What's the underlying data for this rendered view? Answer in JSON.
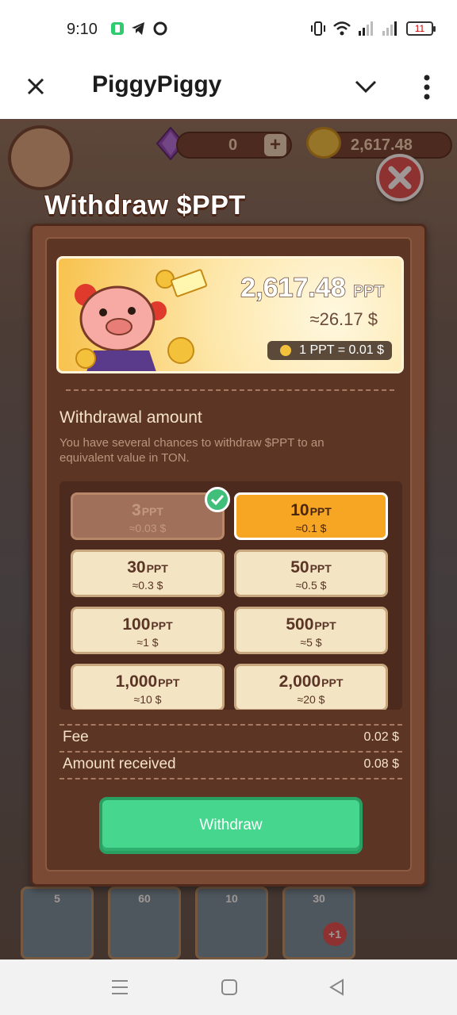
{
  "status_bar": {
    "time": "9:10",
    "battery": "11",
    "icons": [
      "battery-saver-icon",
      "telegram-icon",
      "sync-icon",
      "vibrate-icon",
      "wifi-icon",
      "signal-icon",
      "signal-icon-2"
    ]
  },
  "app_bar": {
    "title": "PiggyPiggy",
    "icons": [
      "close-icon",
      "chevron-down-icon",
      "more-vert-icon"
    ]
  },
  "game_header": {
    "gems": "0",
    "coins": "2,617.48"
  },
  "modal": {
    "title": "Withdraw $PPT",
    "balance_value": "2,617.48",
    "balance_unit": "PPT",
    "balance_usd": "≈26.17 $",
    "rate": "1 PPT = 0.01 $",
    "amount_label": "Withdrawal amount",
    "description": "You have several chances to withdraw $PPT to an equivalent value in TON.",
    "options": [
      {
        "amount": "3",
        "unit": "PPT",
        "usd": "≈0.03 $",
        "state": "used"
      },
      {
        "amount": "10",
        "unit": "PPT",
        "usd": "≈0.1 $",
        "state": "selected"
      },
      {
        "amount": "30",
        "unit": "PPT",
        "usd": "≈0.3 $",
        "state": "normal"
      },
      {
        "amount": "50",
        "unit": "PPT",
        "usd": "≈0.5 $",
        "state": "normal"
      },
      {
        "amount": "100",
        "unit": "PPT",
        "usd": "≈1 $",
        "state": "normal"
      },
      {
        "amount": "500",
        "unit": "PPT",
        "usd": "≈5 $",
        "state": "normal"
      },
      {
        "amount": "1,000",
        "unit": "PPT",
        "usd": "≈10 $",
        "state": "normal"
      },
      {
        "amount": "2,000",
        "unit": "PPT",
        "usd": "≈20 $",
        "state": "normal"
      }
    ],
    "fee_label": "Fee",
    "fee_value": "0.02 $",
    "received_label": "Amount received",
    "received_value": "0.08 $",
    "withdraw_button": "Withdraw"
  },
  "bottom_cards": [
    {
      "cost": "5"
    },
    {
      "cost": "60"
    },
    {
      "cost": "10"
    },
    {
      "cost": "30",
      "badge": "+1"
    }
  ],
  "colors": {
    "modal_bg": "#7b4a35",
    "selected_option": "#f6a623",
    "withdraw_green": "#46d68d",
    "close_red": "#e04848"
  }
}
